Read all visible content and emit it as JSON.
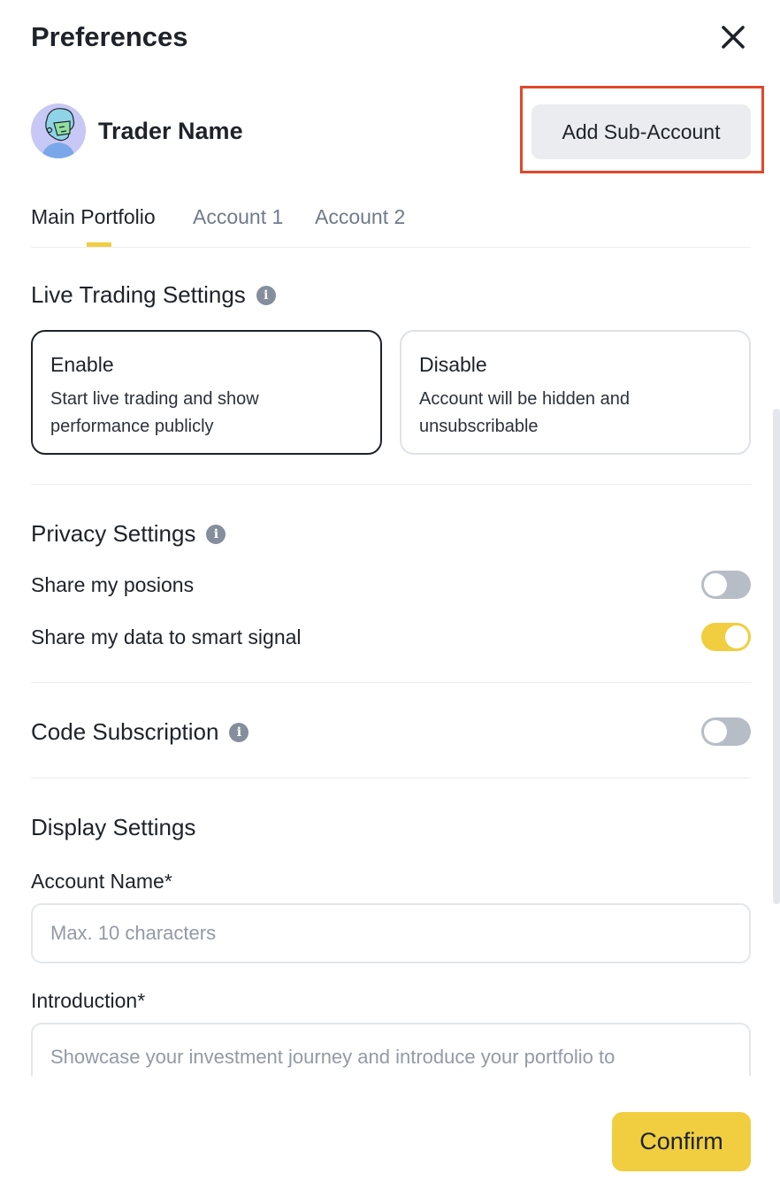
{
  "header": {
    "title": "Preferences",
    "close_icon": "close-icon"
  },
  "profile": {
    "name": "Trader Name",
    "avatar_icon": "avatar-illustration",
    "add_sub_account_label": "Add Sub-Account"
  },
  "tabs": [
    {
      "label": "Main Portfolio",
      "active": true
    },
    {
      "label": "Account 1",
      "active": false
    },
    {
      "label": "Account 2",
      "active": false
    }
  ],
  "live_trading": {
    "title": "Live Trading Settings",
    "options": [
      {
        "title": "Enable",
        "description": "Start live trading and show performance publicly",
        "selected": true
      },
      {
        "title": "Disable",
        "description": "Account will be hidden and unsubscribable",
        "selected": false
      }
    ]
  },
  "privacy": {
    "title": "Privacy Settings",
    "settings": [
      {
        "label": "Share my posions",
        "enabled": false
      },
      {
        "label": "Share my data to smart signal",
        "enabled": true
      }
    ]
  },
  "code_subscription": {
    "title": "Code Subscription",
    "enabled": false
  },
  "display": {
    "title": "Display Settings",
    "account_name_label": "Account Name*",
    "account_name_placeholder": "Max. 10 characters",
    "introduction_label": "Introduction*",
    "introduction_placeholder": "Showcase your investment journey and introduce your portfolio to"
  },
  "footer": {
    "confirm_label": "Confirm"
  },
  "colors": {
    "accent": "#f0ce3f",
    "highlight": "#e1472b",
    "text": "#1e2329"
  }
}
